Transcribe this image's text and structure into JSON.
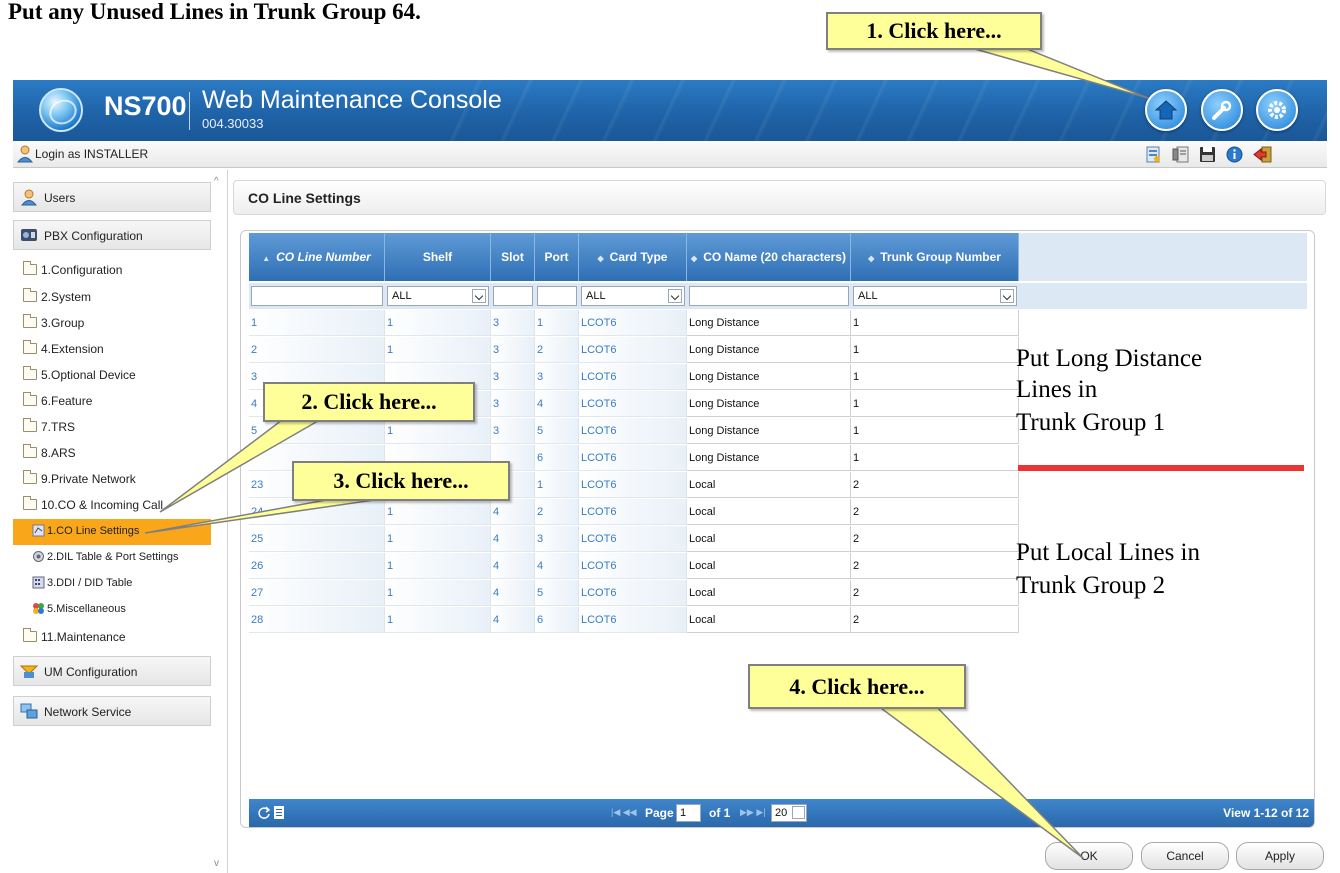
{
  "page": {
    "heading": "Put any Unused Lines in Trunk Group 64."
  },
  "header": {
    "product": "NS700",
    "title": "Web Maintenance Console",
    "version": "004.30033",
    "icons": [
      "home-icon",
      "wrench-icon",
      "gear-icon"
    ]
  },
  "toolbar": {
    "login_text": "Login as INSTALLER",
    "icons": [
      "report-icon",
      "phone-book-icon",
      "save-icon",
      "info-icon",
      "logout-icon"
    ]
  },
  "sidebar": {
    "sections": [
      {
        "label": "Users"
      },
      {
        "label": "PBX Configuration"
      },
      {
        "label": "UM Configuration"
      },
      {
        "label": "Network Service"
      }
    ],
    "items": [
      {
        "label": "1.Configuration"
      },
      {
        "label": "2.System"
      },
      {
        "label": "3.Group"
      },
      {
        "label": "4.Extension"
      },
      {
        "label": "5.Optional Device"
      },
      {
        "label": "6.Feature"
      },
      {
        "label": "7.TRS"
      },
      {
        "label": "8.ARS"
      },
      {
        "label": "9.Private Network"
      },
      {
        "label": "10.CO & Incoming Call"
      },
      {
        "label": "11.Maintenance"
      }
    ],
    "subitems": [
      {
        "label": "1.CO Line Settings"
      },
      {
        "label": "2.DIL Table & Port Settings"
      },
      {
        "label": "3.DDI / DID Table"
      },
      {
        "label": "5.Miscellaneous"
      }
    ]
  },
  "main": {
    "title": "CO Line Settings",
    "columns": [
      "CO Line Number",
      "Shelf",
      "Slot",
      "Port",
      "Card Type",
      "CO Name (20 characters)",
      "Trunk Group Number"
    ],
    "filters": {
      "shelf": "ALL",
      "card_type": "ALL",
      "trunk_group": "ALL"
    },
    "rows": [
      {
        "co": "1",
        "shelf": "1",
        "slot": "3",
        "port": "1",
        "card": "LCOT6",
        "name": "Long Distance",
        "trunk": "1"
      },
      {
        "co": "2",
        "shelf": "1",
        "slot": "3",
        "port": "2",
        "card": "LCOT6",
        "name": "Long Distance",
        "trunk": "1"
      },
      {
        "co": "3",
        "shelf": "",
        "slot": "3",
        "port": "3",
        "card": "LCOT6",
        "name": "Long Distance",
        "trunk": "1"
      },
      {
        "co": "4",
        "shelf": "",
        "slot": "3",
        "port": "4",
        "card": "LCOT6",
        "name": "Long Distance",
        "trunk": "1"
      },
      {
        "co": "5",
        "shelf": "1",
        "slot": "3",
        "port": "5",
        "card": "LCOT6",
        "name": "Long Distance",
        "trunk": "1"
      },
      {
        "co": "",
        "shelf": "",
        "slot": "",
        "port": "6",
        "card": "LCOT6",
        "name": "Long Distance",
        "trunk": "1"
      },
      {
        "co": "23",
        "shelf": "",
        "slot": "",
        "port": "1",
        "card": "LCOT6",
        "name": "Local",
        "trunk": "2"
      },
      {
        "co": "24",
        "shelf": "1",
        "slot": "4",
        "port": "2",
        "card": "LCOT6",
        "name": "Local",
        "trunk": "2"
      },
      {
        "co": "25",
        "shelf": "1",
        "slot": "4",
        "port": "3",
        "card": "LCOT6",
        "name": "Local",
        "trunk": "2"
      },
      {
        "co": "26",
        "shelf": "1",
        "slot": "4",
        "port": "4",
        "card": "LCOT6",
        "name": "Local",
        "trunk": "2"
      },
      {
        "co": "27",
        "shelf": "1",
        "slot": "4",
        "port": "5",
        "card": "LCOT6",
        "name": "Local",
        "trunk": "2"
      },
      {
        "co": "28",
        "shelf": "1",
        "slot": "4",
        "port": "6",
        "card": "LCOT6",
        "name": "Local",
        "trunk": "2"
      }
    ],
    "pager": {
      "page_label": "Page",
      "page_value": "1",
      "of_label": "of 1",
      "per_page": "20",
      "view_text": "View 1-12 of 12"
    },
    "buttons": {
      "ok": "OK",
      "cancel": "Cancel",
      "apply": "Apply"
    }
  },
  "annotations": {
    "step1": "1. Click here...",
    "step2": "2. Click here...",
    "step3": "3. Click here...",
    "step4": "4. Click here...",
    "note_long_1": "Put Long Distance",
    "note_long_2": "Lines in",
    "note_long_3": "Trunk Group 1",
    "note_local_1": "Put Local Lines in",
    "note_local_2": "Trunk Group 2",
    "divider_color": "#ee3333",
    "callout_color": "#ffff99"
  }
}
